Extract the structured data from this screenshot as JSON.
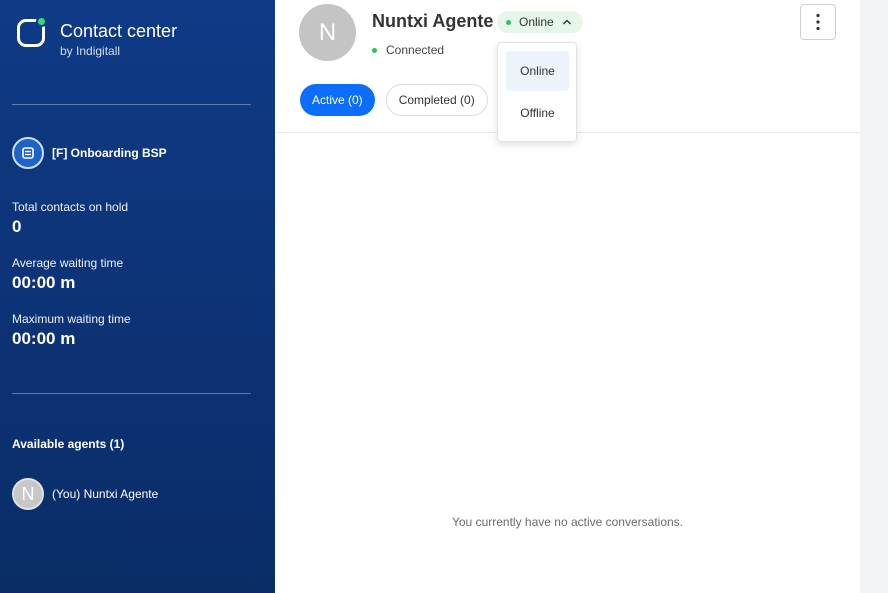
{
  "brand": {
    "title": "Contact center",
    "subtitle": "by Indigitall"
  },
  "queue": {
    "name": "[F] Onboarding BSP"
  },
  "stats": [
    {
      "label": "Total contacts on hold",
      "value": "0"
    },
    {
      "label": "Average waiting time",
      "value": "00:00 m"
    },
    {
      "label": "Maximum waiting time",
      "value": "00:00 m"
    }
  ],
  "agents": {
    "title": "Available agents (1)",
    "list": [
      {
        "initial": "N",
        "name": "(You) Nuntxi Agente"
      }
    ]
  },
  "user": {
    "initial": "N",
    "name": "Nuntxi Agente",
    "status": "Online",
    "connection": "Connected"
  },
  "status_menu": {
    "options": [
      "Online",
      "Offline"
    ],
    "selected": "Online"
  },
  "tabs": [
    {
      "label": "Active (0)",
      "active": true
    },
    {
      "label": "Completed (0)",
      "active": false
    }
  ],
  "empty_message": "You currently have no active conversations.",
  "colors": {
    "sidebar": "#0f3a86",
    "accent": "#0d6efd",
    "online": "#2fbf5a",
    "logo_dot": "#3fd47a"
  }
}
